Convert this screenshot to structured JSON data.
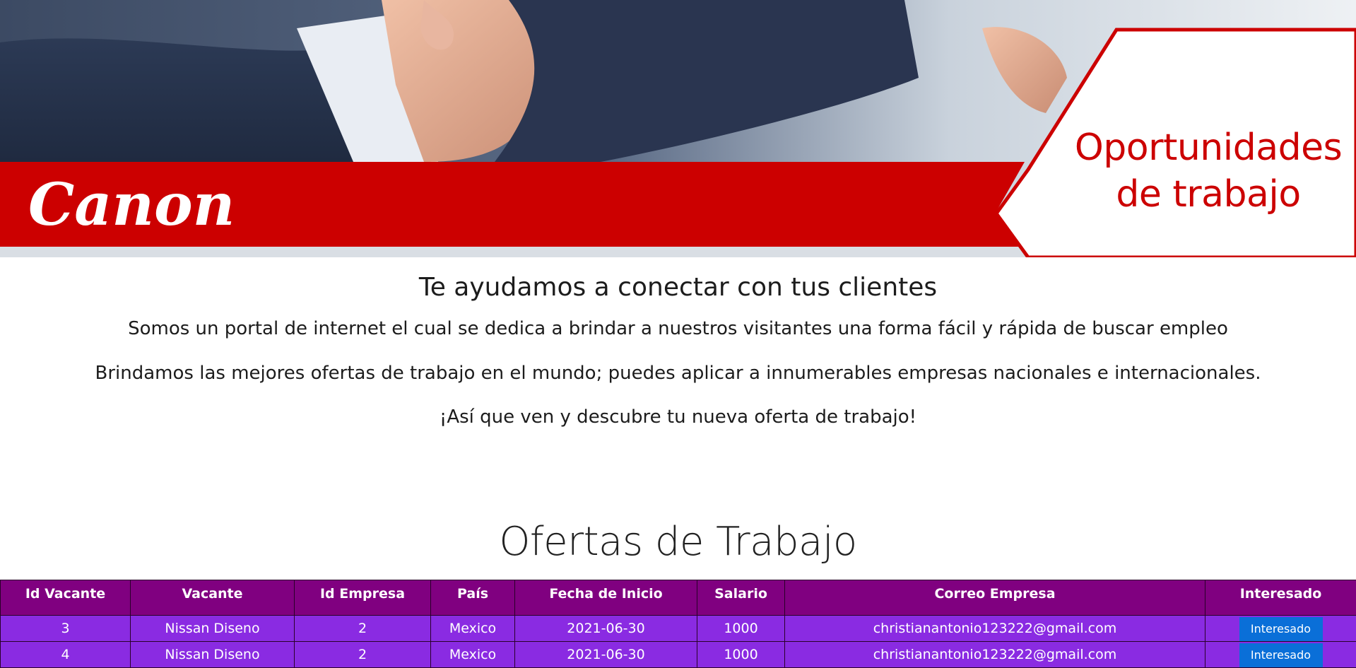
{
  "hero": {
    "logo_text": "Canon",
    "badge_line1": "Oportunidades",
    "badge_line2": "de trabajo",
    "colors": {
      "brand_red": "#cc0000"
    }
  },
  "intro": {
    "heading": "Te ayudamos a conectar con tus clientes",
    "paragraph1": "Somos un portal de internet el cual se dedica a brindar a nuestros visitantes una forma fácil y rápida de buscar empleo",
    "paragraph2": "Brindamos las mejores ofertas de trabajo en el mundo; puedes aplicar a innumerables empresas nacionales e internacionales.",
    "paragraph3": "¡Así que ven y descubre tu nueva oferta de trabajo!"
  },
  "offers": {
    "title": "Ofertas de Trabajo",
    "columns": [
      "Id Vacante",
      "Vacante",
      "Id Empresa",
      "País",
      "Fecha de Inicio",
      "Salario",
      "Correo Empresa",
      "Interesado"
    ],
    "rows": [
      {
        "id": "3",
        "vacante": "Nissan Diseno",
        "id_empresa": "2",
        "pais": "Mexico",
        "fecha": "2021-06-30",
        "salario": "1000",
        "correo": "christianantonio123222@gmail.com",
        "button": "Interesado"
      },
      {
        "id": "4",
        "vacante": "Nissan Diseno",
        "id_empresa": "2",
        "pais": "Mexico",
        "fecha": "2021-06-30",
        "salario": "1000",
        "correo": "christianantonio123222@gmail.com",
        "button": "Interesado"
      }
    ],
    "colors": {
      "header_bg": "#800080",
      "row_bg": "#8a2be2",
      "button_bg": "#0a6fd8"
    }
  }
}
